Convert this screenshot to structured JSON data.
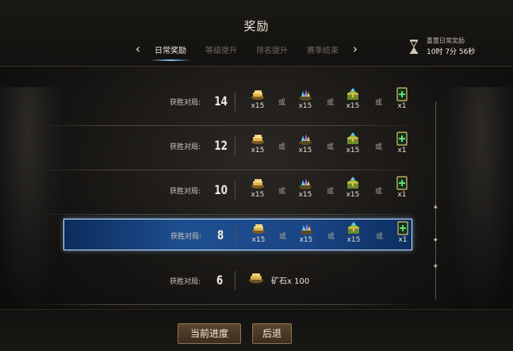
{
  "header": {
    "title": "奖励",
    "tabs": [
      {
        "label": "日常奖励",
        "active": true
      },
      {
        "label": "等级提升",
        "active": false
      },
      {
        "label": "排名提升",
        "active": false
      },
      {
        "label": "赛季结束",
        "active": false
      }
    ],
    "prev_arrow": "‹",
    "next_arrow": "›",
    "reset_label": "重置日常奖励",
    "reset_time": "10时 7分 56秒"
  },
  "rows": [
    {
      "label": "获胜对局:",
      "wins": "14",
      "rewards": [
        {
          "icon": "gold-pile-icon",
          "qty": "x15"
        },
        {
          "icon": "crystal-pile-icon",
          "qty": "x15"
        },
        {
          "icon": "green-chest-icon",
          "qty": "x15"
        },
        {
          "icon": "card-plus-icon",
          "qty": "x1"
        }
      ],
      "or": "或"
    },
    {
      "label": "获胜对局:",
      "wins": "12",
      "rewards": [
        {
          "icon": "gold-pile-icon",
          "qty": "x15"
        },
        {
          "icon": "crystal-pile-icon",
          "qty": "x15"
        },
        {
          "icon": "green-chest-icon",
          "qty": "x15"
        },
        {
          "icon": "card-plus-icon",
          "qty": "x1"
        }
      ],
      "or": "或"
    },
    {
      "label": "获胜对局:",
      "wins": "10",
      "rewards": [
        {
          "icon": "gold-pile-icon",
          "qty": "x15"
        },
        {
          "icon": "crystal-pile-icon",
          "qty": "x15"
        },
        {
          "icon": "green-chest-icon",
          "qty": "x15"
        },
        {
          "icon": "card-plus-icon",
          "qty": "x1"
        }
      ],
      "or": "或"
    },
    {
      "label": "获胜对局:",
      "wins": "8",
      "highlighted": true,
      "rewards": [
        {
          "icon": "gold-pile-icon",
          "qty": "x15"
        },
        {
          "icon": "crystal-pile-icon",
          "qty": "x15"
        },
        {
          "icon": "green-chest-icon",
          "qty": "x15"
        },
        {
          "icon": "card-plus-icon",
          "qty": "x1"
        }
      ],
      "or": "或"
    },
    {
      "label": "获胜对局:",
      "wins": "6",
      "ore_text": "矿石x 100",
      "ore_icon": "ore-icon"
    }
  ],
  "footer": {
    "progress_label": "当前进度",
    "back_label": "后退"
  },
  "colors": {
    "highlight_blue": "#1f4f91",
    "button_brown": "#4a3826"
  }
}
